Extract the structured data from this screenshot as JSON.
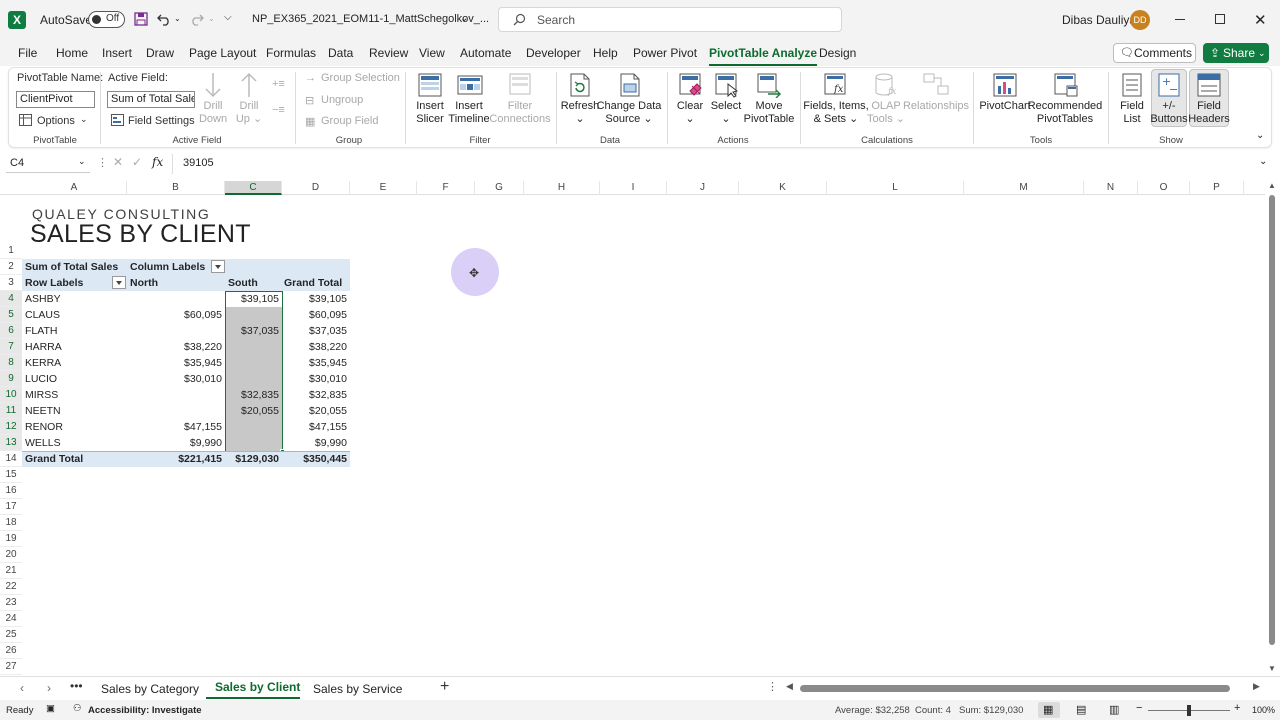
{
  "titlebar": {
    "autosave_label": "AutoSave",
    "autosave_state": "Off",
    "filename": "NP_EX365_2021_EOM11-1_MattSchegolkov_...",
    "search_placeholder": "Search",
    "user_name": "Dibas Dauliya",
    "user_initials": "DD"
  },
  "menu": {
    "tabs": [
      "File",
      "Home",
      "Insert",
      "Draw",
      "Page Layout",
      "Formulas",
      "Data",
      "Review",
      "View",
      "Automate",
      "Developer",
      "Help",
      "Power Pivot",
      "PivotTable Analyze",
      "Design"
    ],
    "active": "PivotTable Analyze",
    "comments_label": "Comments",
    "share_label": "Share"
  },
  "ribbon": {
    "pivottable_name_label": "PivotTable Name:",
    "pivottable_name_value": "ClientPivot",
    "options_label": "Options",
    "group_pivottable": "PivotTable",
    "active_field_label": "Active Field:",
    "active_field_value": "Sum of Total Sales",
    "field_settings_label": "Field Settings",
    "drill_down": [
      "Drill",
      "Down"
    ],
    "drill_up": [
      "Drill",
      "Up"
    ],
    "group_active_field": "Active Field",
    "group_selection": "Group Selection",
    "ungroup": "Ungroup",
    "group_field": "Group Field",
    "group_group": "Group",
    "insert_slicer": [
      "Insert",
      "Slicer"
    ],
    "insert_timeline": [
      "Insert",
      "Timeline"
    ],
    "filter_connections": [
      "Filter",
      "Connections"
    ],
    "group_filter": "Filter",
    "refresh": "Refresh",
    "change_data_source": [
      "Change Data",
      "Source"
    ],
    "group_data": "Data",
    "clear": "Clear",
    "select": "Select",
    "move_pivottable": [
      "Move",
      "PivotTable"
    ],
    "group_actions": "Actions",
    "fields_items_sets": [
      "Fields, Items,",
      "& Sets"
    ],
    "olap_tools": [
      "OLAP",
      "Tools"
    ],
    "relationships": "Relationships",
    "group_calculations": "Calculations",
    "pivotchart": "PivotChart",
    "recommended_pivottables": [
      "Recommended",
      "PivotTables"
    ],
    "group_tools": "Tools",
    "field_list": [
      "Field",
      "List"
    ],
    "plus_minus_buttons": [
      "+/-",
      "Buttons"
    ],
    "field_headers": [
      "Field",
      "Headers"
    ],
    "group_show": "Show"
  },
  "formula_bar": {
    "name_box": "C4",
    "fx": "fx",
    "value": "39105"
  },
  "grid": {
    "columns": [
      "A",
      "B",
      "C",
      "D",
      "E",
      "F",
      "G",
      "H",
      "I",
      "J",
      "K",
      "L",
      "M",
      "N",
      "O",
      "P"
    ],
    "selected_column": "C",
    "rows": [
      "1",
      "2",
      "3",
      "4",
      "5",
      "6",
      "7",
      "8",
      "9",
      "10",
      "11",
      "12",
      "13",
      "14",
      "15",
      "16",
      "17",
      "18",
      "19",
      "20",
      "21",
      "22",
      "23",
      "24",
      "25",
      "26",
      "27"
    ],
    "company": "QUALEY CONSULTING",
    "title": "SALES BY CLIENT",
    "pivot": {
      "corner_label": "Sum of Total Sales",
      "column_labels": "Column Labels",
      "row_labels": "Row Labels",
      "headers": [
        "North",
        "South",
        "Grand Total"
      ],
      "rows": [
        {
          "client": "ASHBY",
          "north": "",
          "south": "$39,105",
          "total": "$39,105"
        },
        {
          "client": "CLAUS",
          "north": "$60,095",
          "south": "",
          "total": "$60,095"
        },
        {
          "client": "FLATH",
          "north": "",
          "south": "$37,035",
          "total": "$37,035"
        },
        {
          "client": "HARRA",
          "north": "$38,220",
          "south": "",
          "total": "$38,220"
        },
        {
          "client": "KERRA",
          "north": "$35,945",
          "south": "",
          "total": "$35,945"
        },
        {
          "client": "LUCIO",
          "north": "$30,010",
          "south": "",
          "total": "$30,010"
        },
        {
          "client": "MIRSS",
          "north": "",
          "south": "$32,835",
          "total": "$32,835"
        },
        {
          "client": "NEETN",
          "north": "",
          "south": "$20,055",
          "total": "$20,055"
        },
        {
          "client": "RENOR",
          "north": "$47,155",
          "south": "",
          "total": "$47,155"
        },
        {
          "client": "WELLS",
          "north": "$9,990",
          "south": "",
          "total": "$9,990"
        }
      ],
      "grand_total_label": "Grand Total",
      "grand_total": {
        "north": "$221,415",
        "south": "$129,030",
        "total": "$350,445"
      }
    }
  },
  "sheets": {
    "tabs": [
      "Sales by Category",
      "Sales by Client",
      "Sales by Service"
    ],
    "active": "Sales by Client"
  },
  "status": {
    "ready": "Ready",
    "accessibility": "Accessibility: Investigate",
    "average": "Average: $32,258",
    "count": "Count: 4",
    "sum": "Sum: $129,030",
    "zoom": "100%"
  },
  "colors": {
    "accent": "#0e6b2e",
    "pivot_header": "#dce9f5",
    "selection": "#c8c8c8",
    "cursor": "#d4c7f5"
  }
}
